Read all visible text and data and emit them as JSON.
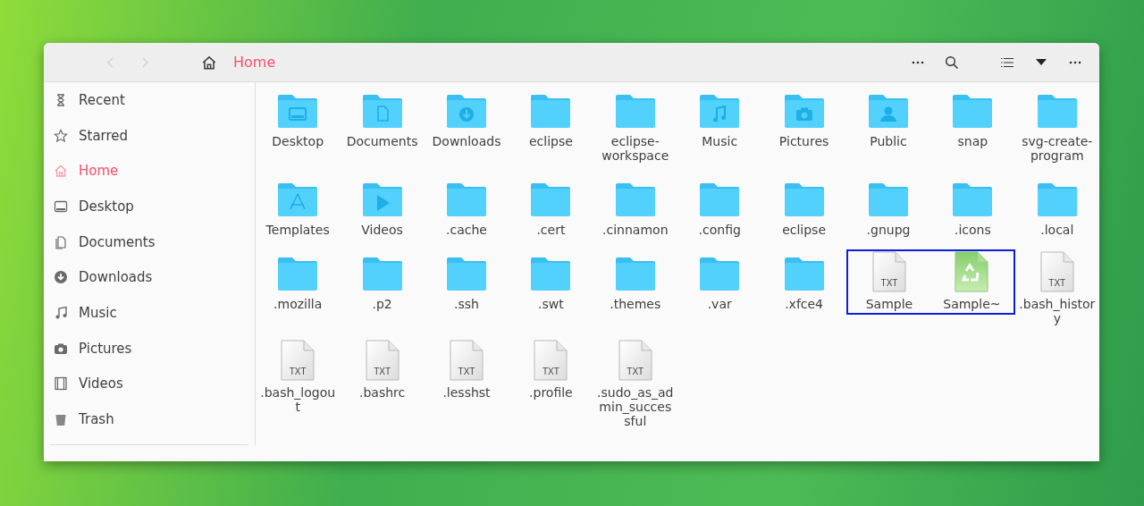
{
  "header": {
    "nav": [
      {
        "kind": "back",
        "disabled": true
      },
      {
        "kind": "forward",
        "disabled": true
      }
    ],
    "location": "Home"
  },
  "sidebar": {
    "items": [
      {
        "kind": "recent",
        "label": "Recent",
        "selected": false
      },
      {
        "kind": "starred",
        "label": "Starred",
        "selected": false
      },
      {
        "kind": "home",
        "label": "Home",
        "selected": true
      },
      {
        "kind": "desktop",
        "label": "Desktop",
        "selected": false
      },
      {
        "kind": "documents",
        "label": "Documents",
        "selected": false
      },
      {
        "kind": "downloads",
        "label": "Downloads",
        "selected": false
      },
      {
        "kind": "music",
        "label": "Music",
        "selected": false
      },
      {
        "kind": "pictures",
        "label": "Pictures",
        "selected": false
      },
      {
        "kind": "videos",
        "label": "Videos",
        "selected": false
      },
      {
        "kind": "trash",
        "label": "Trash",
        "selected": false
      }
    ]
  },
  "items": [
    {
      "kind": "desktop-folder",
      "name": "Desktop",
      "selected": false
    },
    {
      "kind": "documents-folder",
      "name": "Documents",
      "selected": false
    },
    {
      "kind": "downloads-folder",
      "name": "Downloads",
      "selected": false
    },
    {
      "kind": "folder",
      "name": "eclipse",
      "selected": false
    },
    {
      "kind": "folder",
      "name": "eclipse-workspace",
      "selected": false
    },
    {
      "kind": "music-folder",
      "name": "Music",
      "selected": false
    },
    {
      "kind": "pictures-folder",
      "name": "Pictures",
      "selected": false
    },
    {
      "kind": "public-folder",
      "name": "Public",
      "selected": false
    },
    {
      "kind": "folder",
      "name": "snap",
      "selected": false
    },
    {
      "kind": "folder",
      "name": "svg-create-program",
      "selected": false
    },
    {
      "kind": "templates-folder",
      "name": "Templates",
      "selected": false
    },
    {
      "kind": "videos-folder",
      "name": "Videos",
      "selected": false
    },
    {
      "kind": "folder",
      "name": ".cache",
      "selected": false
    },
    {
      "kind": "folder",
      "name": ".cert",
      "selected": false
    },
    {
      "kind": "folder",
      "name": ".cinnamon",
      "selected": false
    },
    {
      "kind": "folder",
      "name": ".config",
      "selected": false
    },
    {
      "kind": "folder",
      "name": "eclipse",
      "selected": false
    },
    {
      "kind": "folder",
      "name": ".gnupg",
      "selected": false
    },
    {
      "kind": "folder",
      "name": ".icons",
      "selected": false
    },
    {
      "kind": "folder",
      "name": ".local",
      "selected": false
    },
    {
      "kind": "folder",
      "name": ".mozilla",
      "selected": false
    },
    {
      "kind": "folder",
      "name": ".p2",
      "selected": false
    },
    {
      "kind": "folder",
      "name": ".ssh",
      "selected": false
    },
    {
      "kind": "folder",
      "name": ".swt",
      "selected": false
    },
    {
      "kind": "folder",
      "name": ".themes",
      "selected": false
    },
    {
      "kind": "folder",
      "name": ".var",
      "selected": false
    },
    {
      "kind": "folder",
      "name": ".xfce4",
      "selected": false
    },
    {
      "kind": "text-file",
      "name": "Sample",
      "badge": "TXT",
      "selected": true
    },
    {
      "kind": "backup-file",
      "name": "Sample~",
      "selected": true
    },
    {
      "kind": "text-file",
      "name": ".bash_history",
      "badge": "TXT",
      "selected": false
    },
    {
      "kind": "text-file",
      "name": ".bash_logout",
      "badge": "TXT",
      "selected": false
    },
    {
      "kind": "text-file",
      "name": ".bashrc",
      "badge": "TXT",
      "selected": false
    },
    {
      "kind": "text-file",
      "name": ".lesshst",
      "badge": "TXT",
      "selected": false
    },
    {
      "kind": "text-file",
      "name": ".profile",
      "badge": "TXT",
      "selected": false
    },
    {
      "kind": "text-file",
      "name": ".sudo_as_admin_successful",
      "badge": "TXT",
      "selected": false
    }
  ]
}
